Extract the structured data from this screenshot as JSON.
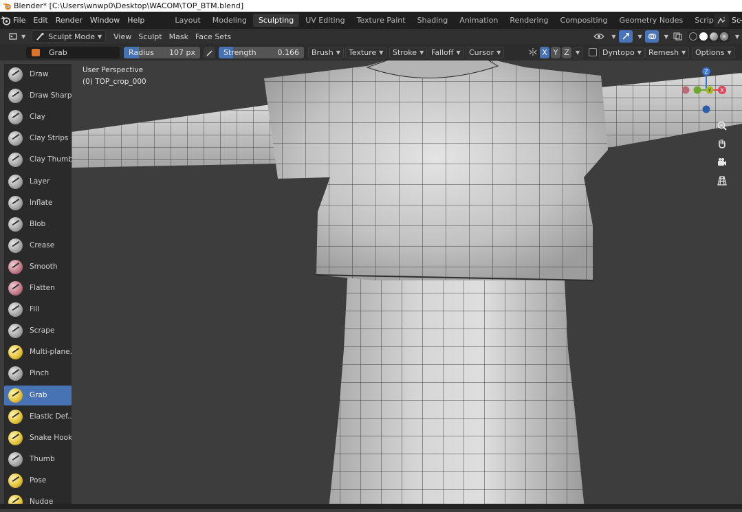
{
  "window": {
    "title": "Blender* [C:\\Users\\wnwp0\\Desktop\\WACOM\\TOP_BTM.blend]"
  },
  "menu": [
    "File",
    "Edit",
    "Render",
    "Window",
    "Help"
  ],
  "workspaces": {
    "tabs": [
      "Layout",
      "Modeling",
      "Sculpting",
      "UV Editing",
      "Texture Paint",
      "Shading",
      "Animation",
      "Rendering",
      "Compositing",
      "Geometry Nodes",
      "Scripting"
    ],
    "active": "Sculpting",
    "scene_label": "Sc"
  },
  "header": {
    "mode": "Sculpt Mode",
    "menus": [
      "View",
      "Sculpt",
      "Mask",
      "Face Sets"
    ]
  },
  "tool_settings": {
    "tool_name": "Grab",
    "radius_label": "Radius",
    "radius_value": "107 px",
    "strength_label": "Strength",
    "strength_value": "0.166",
    "strength_fraction": 0.166,
    "dropdowns": [
      "Brush",
      "Texture",
      "Stroke",
      "Falloff",
      "Cursor"
    ],
    "axes": [
      "X",
      "Y",
      "Z"
    ],
    "dyntopo": "Dyntopo",
    "remesh": "Remesh",
    "options": "Options"
  },
  "tools": [
    {
      "label": "Draw",
      "color": "gray"
    },
    {
      "label": "Draw Sharp",
      "color": "gray"
    },
    {
      "label": "Clay",
      "color": "gray"
    },
    {
      "label": "Clay Strips",
      "color": "gray"
    },
    {
      "label": "Clay Thumb",
      "color": "gray"
    },
    {
      "label": "Layer",
      "color": "gray"
    },
    {
      "label": "Inflate",
      "color": "gray"
    },
    {
      "label": "Blob",
      "color": "gray"
    },
    {
      "label": "Crease",
      "color": "gray"
    },
    {
      "label": "Smooth",
      "color": "pink"
    },
    {
      "label": "Flatten",
      "color": "pink"
    },
    {
      "label": "Fill",
      "color": "gray"
    },
    {
      "label": "Scrape",
      "color": "gray"
    },
    {
      "label": "Multi-plane...",
      "color": "yellow"
    },
    {
      "label": "Pinch",
      "color": "gray"
    },
    {
      "label": "Grab",
      "color": "yellow",
      "active": true
    },
    {
      "label": "Elastic Def...",
      "color": "yellow"
    },
    {
      "label": "Snake Hook",
      "color": "yellow"
    },
    {
      "label": "Thumb",
      "color": "gray"
    },
    {
      "label": "Pose",
      "color": "yellow"
    },
    {
      "label": "Nudge",
      "color": "yellow"
    }
  ],
  "viewport": {
    "perspective": "User Perspective",
    "object": "(0) TOP_crop_000",
    "gizmo": {
      "z": "Z",
      "y": "Y",
      "x": "X"
    }
  },
  "colors": {
    "accent": "#4772b3",
    "viewport_bg": "#3d3d3d",
    "mesh": "#c8c8c8",
    "axis_x": "#e04458",
    "axis_y": "#6fa62c",
    "axis_z": "#3a78d6"
  }
}
